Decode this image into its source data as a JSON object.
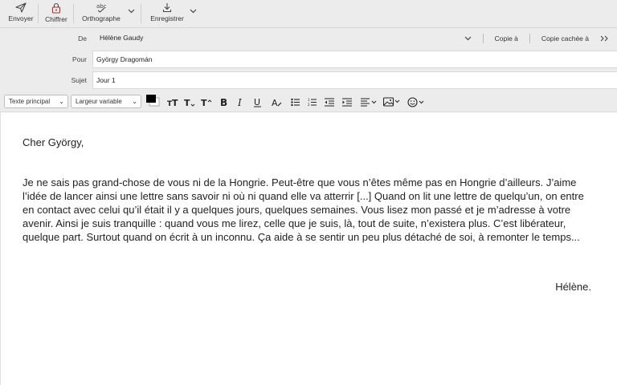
{
  "toolbar": {
    "send": "Envoyer",
    "encrypt": "Chiffrer",
    "spelling": "Orthographe",
    "save": "Enregistrer"
  },
  "header": {
    "from_label": "De",
    "from_value": "Hélène Gaudy",
    "cc_label": "Copie à",
    "bcc_label": "Copie cachée à",
    "to_label": "Pour",
    "to_value": "György Dragomán",
    "subject_label": "Sujet",
    "subject_value": "Jour 1"
  },
  "format": {
    "paragraph_style": "Texte principal",
    "width_style": "Largeur variable",
    "text_color": "#000000"
  },
  "message": {
    "greeting": "Cher György,",
    "paragraph": "Je ne sais pas grand-chose de vous ni de la Hongrie. Peut-être que vous n’êtes même pas en Hongrie d’ailleurs. J’aime l’idée de lancer ainsi une lettre sans savoir ni où ni quand elle va atterrir [...] Quand on lit une lettre de quelqu’un, on entre en contact avec celui qu’il était il y a quelques jours, quelques semaines. Vous lisez mon passé et je m’adresse à votre avenir. Ainsi je suis tranquille : quand vous me lirez, celle que je suis, là, tout de suite, n’existera plus. C’est libérateur, quelque part. Surtout quand on écrit à un inconnu. Ça aide à se sentir un peu plus détaché de soi, à remonter le temps...",
    "signature": "Hélène."
  }
}
